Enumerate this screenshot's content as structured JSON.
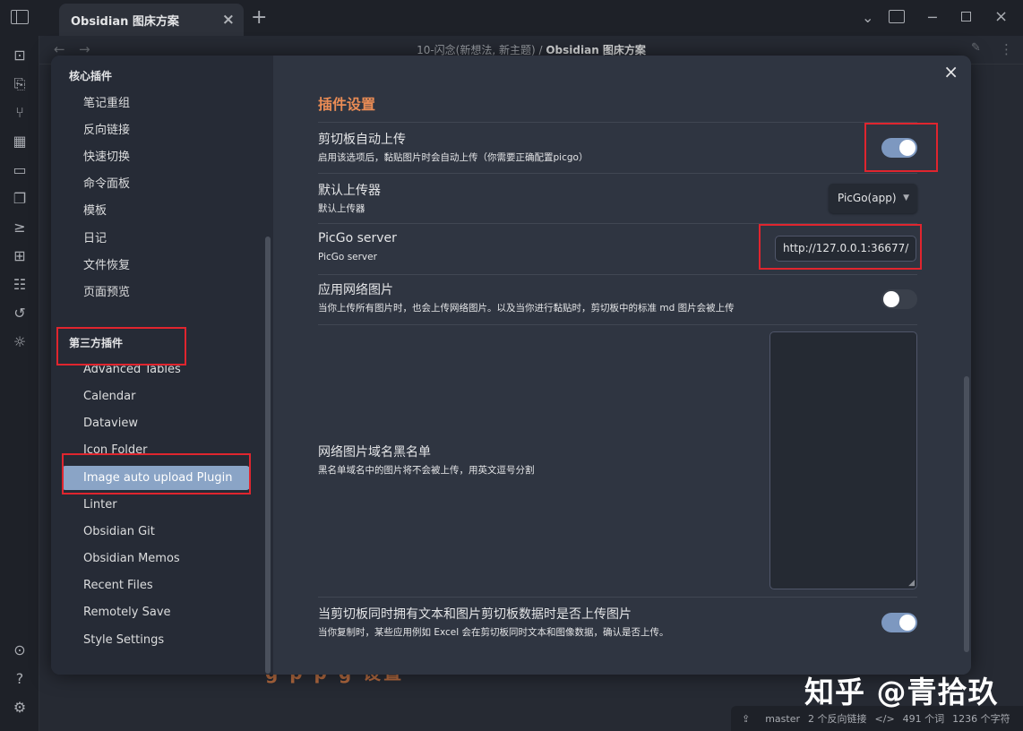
{
  "titlebar": {
    "tab_title": "Obsidian 图床方案",
    "tab_close": "×",
    "new_tab": "+"
  },
  "view_header": {
    "breadcrumb_path": "10-闪念(新想法, 新主题) / ",
    "breadcrumb_current": "Obsidian 图床方案"
  },
  "background_text": "g         p     p   g   设置",
  "watermark": "知乎 @青拾玖",
  "statusbar": {
    "branch": "master",
    "backlinks": "2 个反向链接",
    "code_icon": "</>",
    "words": "491 个词",
    "chars": "1236 个字符"
  },
  "modal": {
    "close": "×",
    "core_heading": "核心插件",
    "core_plugins": [
      "笔记重组",
      "反向链接",
      "快速切换",
      "命令面板",
      "模板",
      "日记",
      "文件恢复",
      "页面预览"
    ],
    "third_heading": "第三方插件",
    "third_plugins": [
      "Advanced Tables",
      "Calendar",
      "Dataview",
      "Icon Folder",
      "Image auto upload Plugin",
      "Linter",
      "Obsidian Git",
      "Obsidian Memos",
      "Recent Files",
      "Remotely Save",
      "Style Settings"
    ],
    "active_plugin": "Image auto upload Plugin"
  },
  "settings": {
    "title": "插件设置",
    "clipboard_upload": {
      "name": "剪切板自动上传",
      "desc": "启用该选项后，黏贴图片时会自动上传（你需要正确配置picgo）",
      "enabled": true
    },
    "default_uploader": {
      "name": "默认上传器",
      "desc": "默认上传器",
      "value": "PicGo(app)"
    },
    "picgo_server": {
      "name": "PicGo server",
      "desc": "PicGo server",
      "value": "http://127.0.0.1:36677/"
    },
    "network_images": {
      "name": "应用网络图片",
      "desc": "当你上传所有图片时，也会上传网络图片。以及当你进行黏贴时，剪切板中的标准 md 图片会被上传",
      "enabled": false
    },
    "domain_blacklist": {
      "name": "网络图片域名黑名单",
      "desc": "黑名单域名中的图片将不会被上传，用英文逗号分割",
      "value": ""
    },
    "upload_mixed_clipboard": {
      "name": "当剪切板同时拥有文本和图片剪切板数据时是否上传图片",
      "desc": "当你复制时，某些应用例如 Excel 会在剪切板同时文本和图像数据，确认是否上传。",
      "enabled": true
    }
  },
  "colors": {
    "accent": "#ea8c55",
    "toggle_on": "#7d98c0",
    "active_item": "#8aa4c6",
    "highlight_box": "#e0252e"
  }
}
